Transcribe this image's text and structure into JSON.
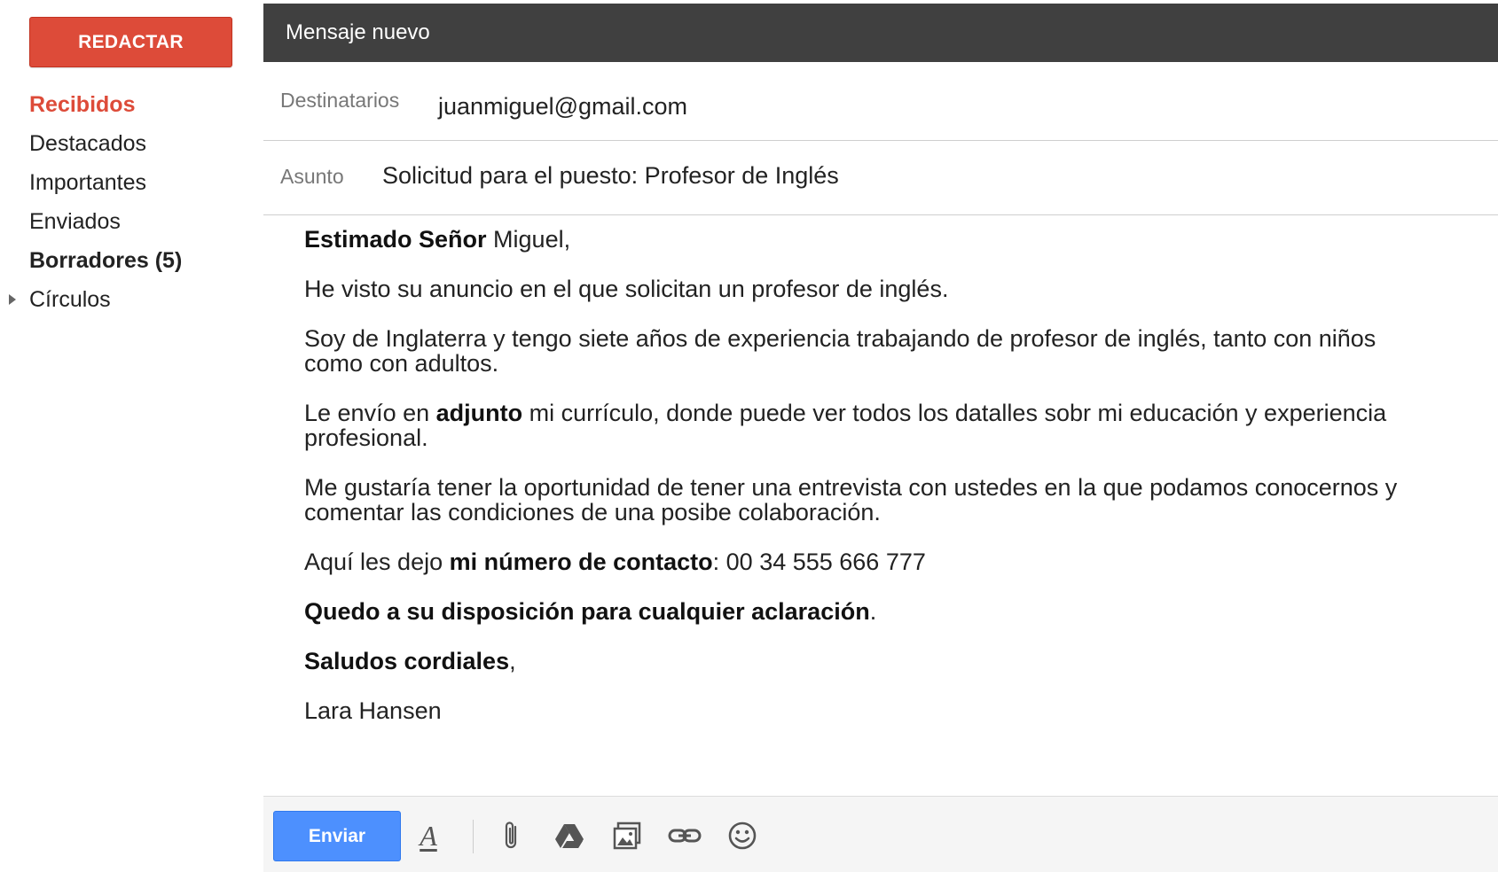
{
  "sidebar": {
    "compose_label": "REDACTAR",
    "items": [
      {
        "label": "Recibidos"
      },
      {
        "label": "Destacados"
      },
      {
        "label": "Importantes"
      },
      {
        "label": "Enviados"
      },
      {
        "label": "Borradores (5)"
      },
      {
        "label": "Círculos"
      }
    ]
  },
  "compose": {
    "title": "Mensaje nuevo",
    "to_label": "Destinatarios",
    "to_value": "juanmiguel@gmail.com",
    "subject_label": "Asunto",
    "subject_value": "Solicitud para el puesto: Profesor de Inglés",
    "body": {
      "greeting_bold": "Estimado Señor",
      "greeting_rest": " Miguel,",
      "p1": "He visto su anuncio en el que solicitan un profesor de inglés.",
      "p2": "Soy de Inglaterra y tengo siete años de experiencia trabajando de profesor de inglés, tanto con niños como con adultos.",
      "p3_a": "Le envío en ",
      "p3_bold": "adjunto",
      "p3_b": " mi currículo, donde puede ver todos los datalles sobr mi educación y experiencia profesional.",
      "p4": "Me gustaría tener la oportunidad de tener una entrevista con ustedes en la que podamos conocernos y comentar las condiciones de una posibe colaboración.",
      "p5_a": "Aquí les dejo ",
      "p5_bold": "mi número de contacto",
      "p5_b": ": 00 34 555 666 777",
      "p6_bold": "Quedo a su disposición para cualquier aclaración",
      "p6_rest": ".",
      "p7_bold": "Saludos cordiales",
      "p7_rest": ",",
      "signature": "Lara Hansen"
    },
    "send_label": "Enviar",
    "format_glyph": "A",
    "toolbar_icons": [
      "format-text-icon",
      "paperclip-icon",
      "drive-icon",
      "image-icon",
      "link-icon",
      "emoji-icon"
    ]
  },
  "colors": {
    "compose_button": "#dd4b39",
    "active_nav": "#dd4b39",
    "header_bg": "#404040",
    "send_button": "#4d90fe"
  }
}
